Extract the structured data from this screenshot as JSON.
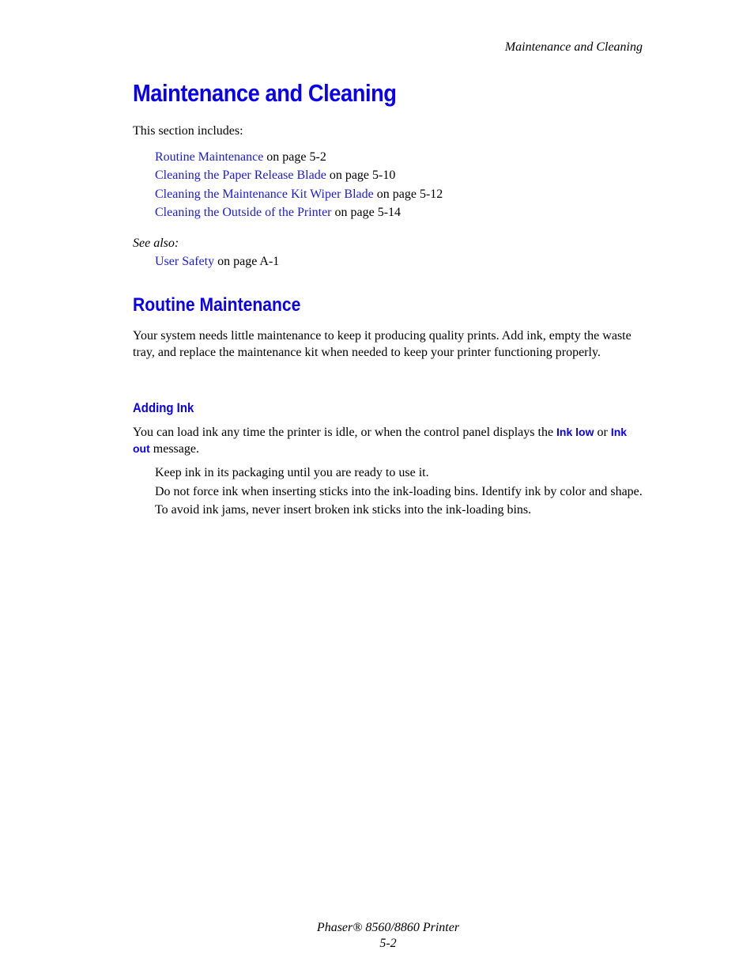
{
  "running_header": "Maintenance and Cleaning",
  "title": "Maintenance and Cleaning",
  "intro": "This section includes:",
  "toc": [
    {
      "link": "Routine Maintenance",
      "page": " on page 5-2"
    },
    {
      "link": "Cleaning the Paper Release Blade",
      "page": " on page 5-10"
    },
    {
      "link": "Cleaning the Maintenance Kit Wiper Blade",
      "page": " on page 5-12"
    },
    {
      "link": "Cleaning the Outside of the Printer",
      "page": " on page 5-14"
    }
  ],
  "see_also": {
    "label": "See also:",
    "link": "User Safety",
    "page": " on page A-1"
  },
  "routine": {
    "heading": "Routine Maintenance",
    "body": "Your system needs little maintenance to keep it producing quality prints. Add ink, empty the waste tray, and replace the maintenance kit when needed to keep your printer functioning properly."
  },
  "adding_ink": {
    "heading": "Adding Ink",
    "body_pre": "You can load ink any time the printer is idle, or when the control panel displays the ",
    "term1": "Ink low",
    "body_mid": " or ",
    "term2": "Ink out",
    "body_post": " message.",
    "bullets": [
      "Keep ink in its packaging until you are ready to use it.",
      "Do not force ink when inserting sticks into the ink-loading bins. Identify ink by color and shape.",
      "To avoid ink jams, never insert broken ink sticks into the ink-loading bins."
    ]
  },
  "footer": {
    "product": "Phaser® 8560/8860 Printer",
    "page_number": "5-2"
  }
}
